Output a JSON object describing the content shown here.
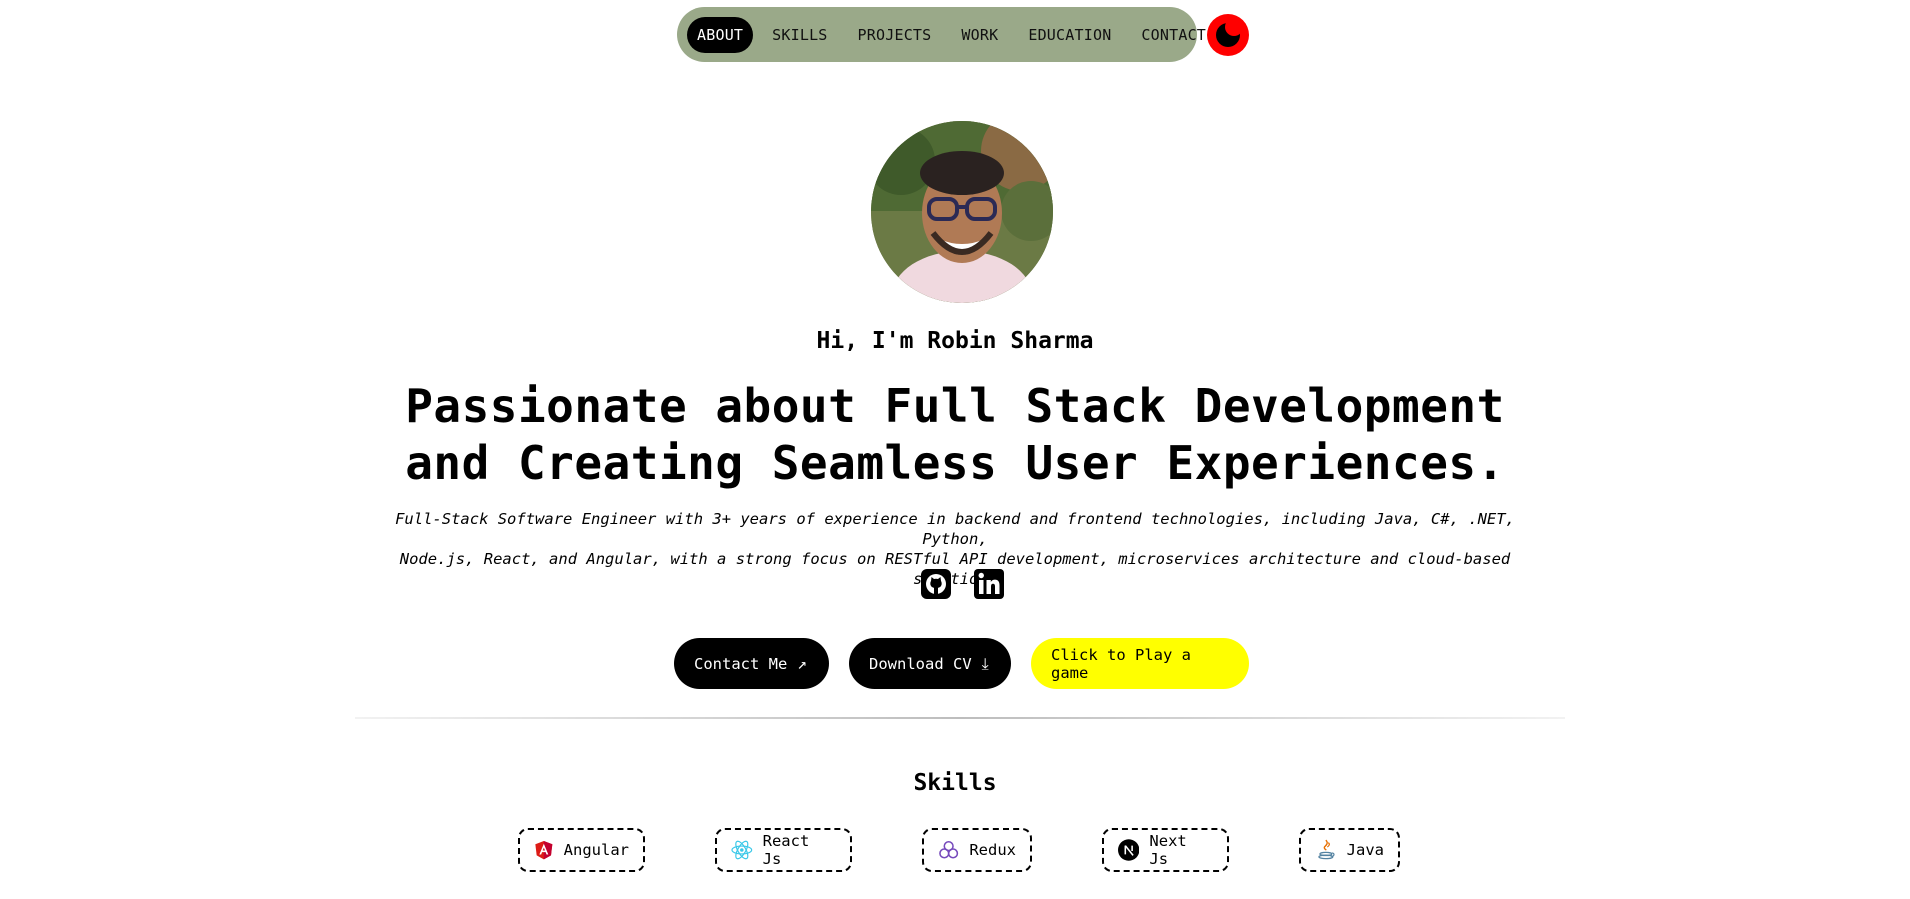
{
  "nav": {
    "items": [
      {
        "label": "ABOUT",
        "active": true
      },
      {
        "label": "SKILLS",
        "active": false
      },
      {
        "label": "PROJECTS",
        "active": false
      },
      {
        "label": "WORK",
        "active": false
      },
      {
        "label": "EDUCATION",
        "active": false
      },
      {
        "label": "CONTACT",
        "active": false
      }
    ],
    "pill_color": "#9aa989",
    "theme_toggle": {
      "icon": "moon-icon",
      "color": "#ff0000"
    }
  },
  "hero": {
    "greeting": "Hi, I'm Robin Sharma",
    "headline_line1": "Passionate about Full Stack Development",
    "headline_line2": "and Creating Seamless User Experiences.",
    "summary_line1": "Full-Stack Software Engineer with 3+ years of experience in backend and frontend technologies, including Java, C#, .NET, Python,",
    "summary_line2": "Node.js, React, and Angular, with a strong focus on RESTful API development, microservices architecture and cloud-based solutions",
    "socials": [
      {
        "icon": "github-icon"
      },
      {
        "icon": "linkedin-icon"
      }
    ],
    "buttons": {
      "contact": {
        "label": "Contact Me",
        "icon": "arrow-up-right-icon"
      },
      "download": {
        "label": "Download CV",
        "icon": "download-icon"
      },
      "game": {
        "label": "Click to Play a game",
        "color": "#ffff00"
      }
    }
  },
  "skills": {
    "title": "Skills",
    "items": [
      {
        "label": "Angular",
        "icon": "angular-icon"
      },
      {
        "label": "React Js",
        "icon": "react-icon"
      },
      {
        "label": "Redux",
        "icon": "redux-icon"
      },
      {
        "label": "Next Js",
        "icon": "nextjs-icon"
      },
      {
        "label": "Java",
        "icon": "java-icon"
      }
    ]
  }
}
